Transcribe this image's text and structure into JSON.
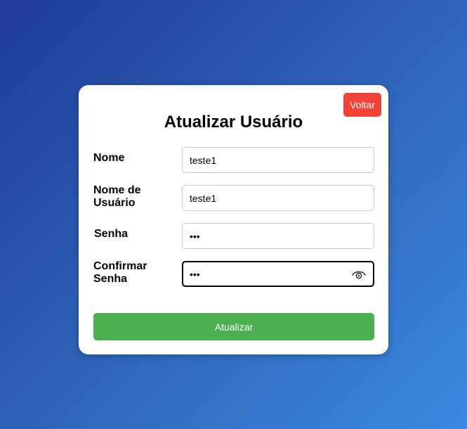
{
  "form": {
    "back_label": "Voltar",
    "title": "Atualizar Usuário",
    "fields": [
      {
        "label": "Nome",
        "value": "teste1",
        "type": "text"
      },
      {
        "label": "Nome de Usuário",
        "value": "teste1",
        "type": "text"
      },
      {
        "label": "Senha",
        "value": "123",
        "type": "password"
      },
      {
        "label": "Confirmar Senha",
        "value": "123",
        "type": "password"
      }
    ],
    "submit_label": "Atualizar"
  },
  "colors": {
    "back_button": "#f44336",
    "submit_button": "#4caf50",
    "background_start": "#1f3c98",
    "background_end": "#3a8be0"
  },
  "icons": {
    "show_password": "eye-icon"
  }
}
